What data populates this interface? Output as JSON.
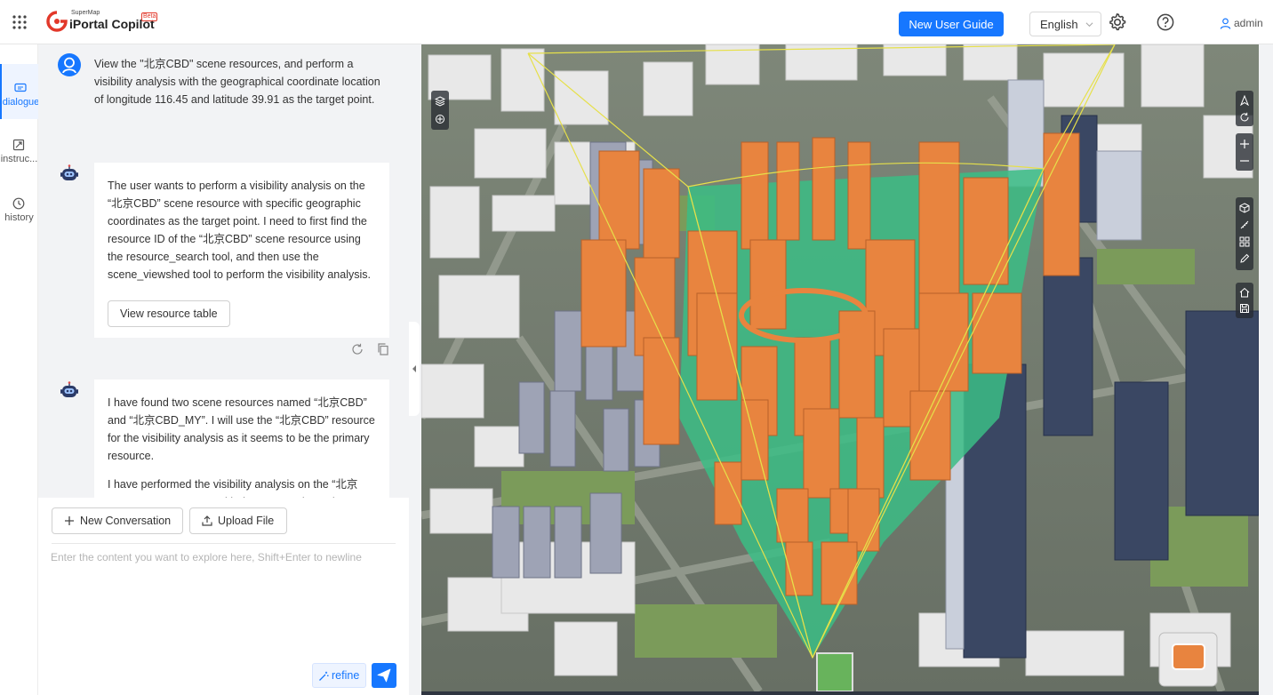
{
  "header": {
    "logo_supertext": "SuperMap",
    "logo_title": "iPortal Copilot",
    "logo_badge": "Beta",
    "guide_button": "New User Guide",
    "language": "English",
    "username": "admin"
  },
  "nav": {
    "items": [
      {
        "label": "dialogue",
        "icon": "dialogue-icon"
      },
      {
        "label": "instruc...",
        "icon": "instruction-icon"
      },
      {
        "label": "history",
        "icon": "history-icon"
      }
    ]
  },
  "chat": {
    "user_message": "View the \"北京CBD\" scene resources, and perform a visibility analysis with the geographical coordinate location of longitude 116.45 and latitude 39.91 as the target point.",
    "bot_message_1": "The user wants to perform a visibility analysis on the “北京CBD” scene resource with specific geographic coordinates as the target point. I need to first find the resource ID of the “北京CBD” scene resource using the resource_search tool, and then use the scene_viewshed tool to perform the visibility analysis.",
    "resource_button": "View resource table",
    "bot_message_2a": "I have found two scene resources named “北京CBD” and “北京CBD_MY”. I will use the “北京CBD” resource for the visibility analysis as it seems to be the primary resource.",
    "bot_message_2b": "I have performed the visibility analysis on the “北京CBD” scene resource with the target point at the"
  },
  "composer": {
    "new_conversation": "New Conversation",
    "upload_file": "Upload File",
    "placeholder": "Enter the content you want to explore here, Shift+Enter to newline",
    "refine": "refine"
  },
  "colors": {
    "accent": "#1677ff",
    "visible_area": "#3bbd85",
    "invisible_buildings": "#e8843f",
    "viewshed_frustum": "#e6e04a"
  }
}
